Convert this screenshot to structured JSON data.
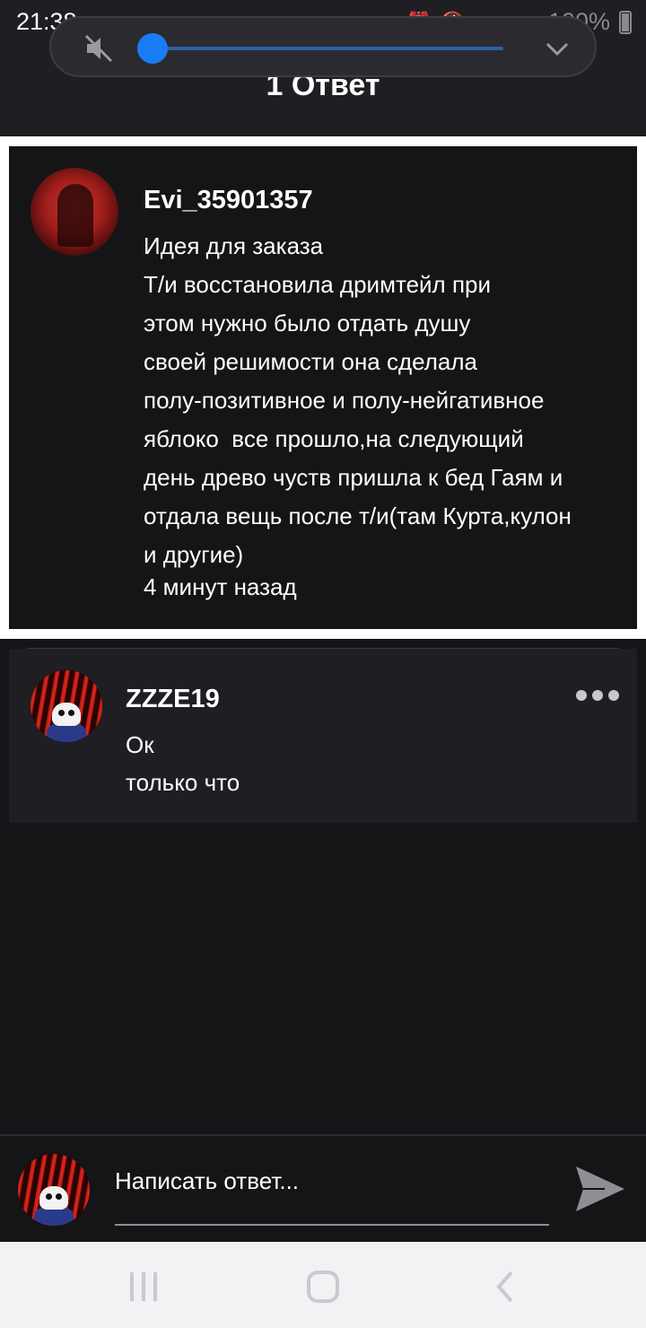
{
  "status_bar": {
    "time": "21:38",
    "battery": "100%",
    "icons": [
      "alarm-icon",
      "mute-icon",
      "wifi-icon",
      "signal-icon",
      "battery-icon"
    ]
  },
  "header": {
    "title": "1 Ответ"
  },
  "volume_panel": {
    "level": 0.0,
    "accent_color": "#1a7cf5",
    "icons": [
      "volume-mute-icon",
      "chevron-down-icon"
    ]
  },
  "main_comment": {
    "author": "Evi_35901357",
    "lines": [
      "Идея для заказа",
      "Т/и восстановила дримтейл при",
      "этом нужно было отдать душу",
      "своей решимости она сделала",
      "полу-позитивное и полу-нейгативное",
      "яблоко  все прошло,на следующий",
      "день древо чуств пришла к бед Гаям и",
      "отдала вещь после т/и(там Курта,кулон",
      "и другие)"
    ],
    "time": "4 минут назад"
  },
  "reply": {
    "author": "ZZZE19",
    "text": "Ок",
    "time": "только что",
    "more_icon": "more-horizontal-icon"
  },
  "compose": {
    "placeholder": "Написать ответ...",
    "send_icon": "send-icon"
  },
  "nav": {
    "icons": [
      "recents-icon",
      "home-icon",
      "back-icon"
    ]
  }
}
